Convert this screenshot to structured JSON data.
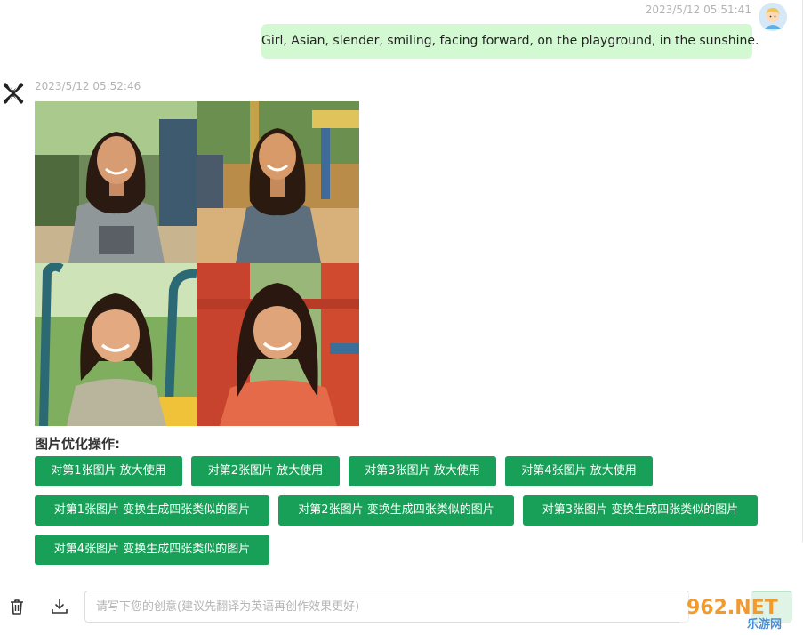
{
  "user_message": {
    "timestamp": "2023/5/12 05:51:41",
    "text": "Girl, Asian, slender, smiling, facing forward, on the playground, in the sunshine."
  },
  "bot_message": {
    "timestamp": "2023/5/12 05:52:46",
    "ops_title": "图片优化操作:",
    "upscale_buttons": [
      "对第1张图片 放大使用",
      "对第2张图片 放大使用",
      "对第3张图片 放大使用",
      "对第4张图片 放大使用"
    ],
    "variation_buttons": [
      "对第1张图片 变换生成四张类似的图片",
      "对第2张图片 变换生成四张类似的图片",
      "对第3张图片 变换生成四张类似的图片",
      "对第4张图片 变换生成四张类似的图片"
    ]
  },
  "input": {
    "placeholder": "请写下您的创意(建议先翻译为英语再创作效果更好)"
  },
  "watermark": {
    "top": "962.NET",
    "bottom": "乐游网"
  },
  "icons": {
    "delete": "trash-icon",
    "download": "download-icon",
    "bot": "x-logo-icon",
    "send": "send-icon"
  },
  "colors": {
    "accent": "#18a058",
    "user_bubble": "#d2f9d1",
    "timestamp": "#b4b4b4"
  }
}
